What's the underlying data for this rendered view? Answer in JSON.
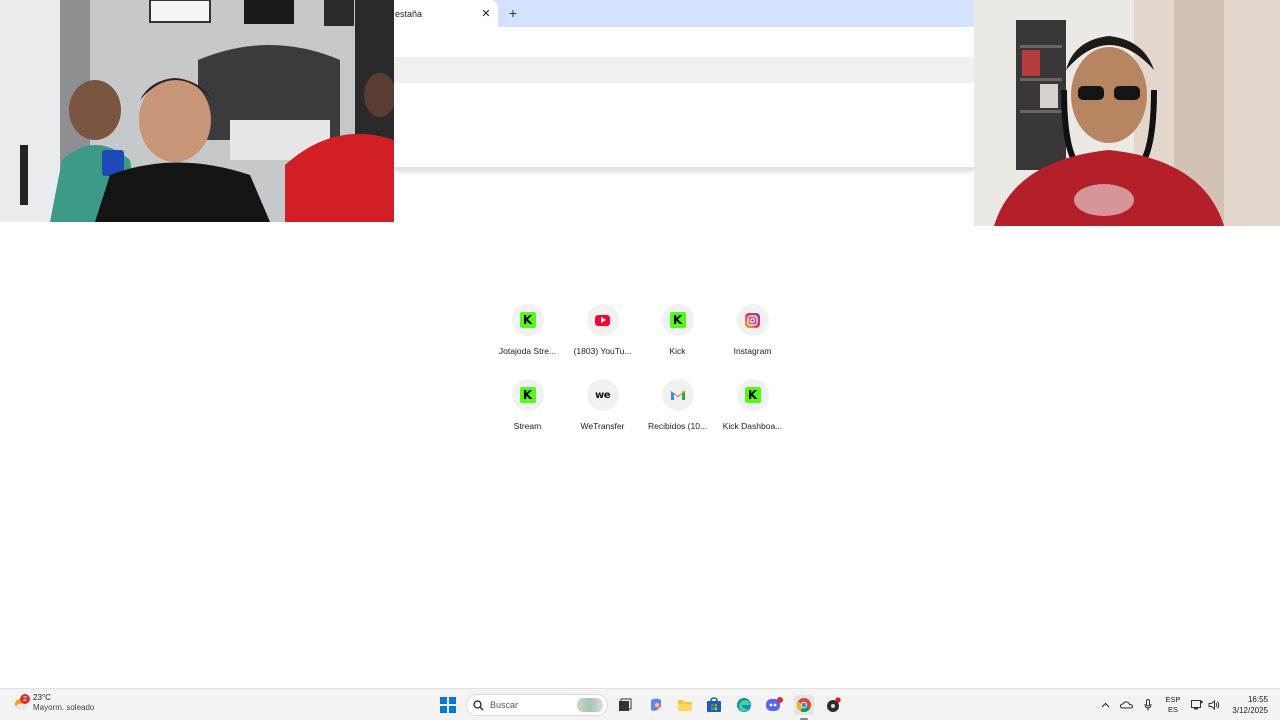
{
  "browser": {
    "tab_title": "estaña",
    "tab_close": "✕",
    "new_tab": "+"
  },
  "shortcuts": [
    {
      "label": "Jotajoda Stre...",
      "icon": "kick-icon"
    },
    {
      "label": "(1803) YouTu...",
      "icon": "youtube-icon"
    },
    {
      "label": "Kick",
      "icon": "kick-icon"
    },
    {
      "label": "Instagram",
      "icon": "instagram-icon"
    },
    {
      "label": "Stream",
      "icon": "kick-icon"
    },
    {
      "label": "WeTransfer",
      "icon": "wetransfer-icon"
    },
    {
      "label": "Recibidos (10...",
      "icon": "gmail-icon"
    },
    {
      "label": "Kick Dashboa...",
      "icon": "kick-icon"
    }
  ],
  "taskbar": {
    "weather_badge": "2",
    "temperature": "23°C",
    "condition": "Mayorm. soleado",
    "search_placeholder": "Buscar",
    "lang_top": "ESP",
    "lang_bottom": "ES",
    "time": "16:55",
    "date": "3/12/2025"
  },
  "colors": {
    "kick_green": "#53fc18",
    "youtube_red": "#ff0033",
    "windows_blue": "#0078d4",
    "tabstrip": "#d3e3fd"
  }
}
